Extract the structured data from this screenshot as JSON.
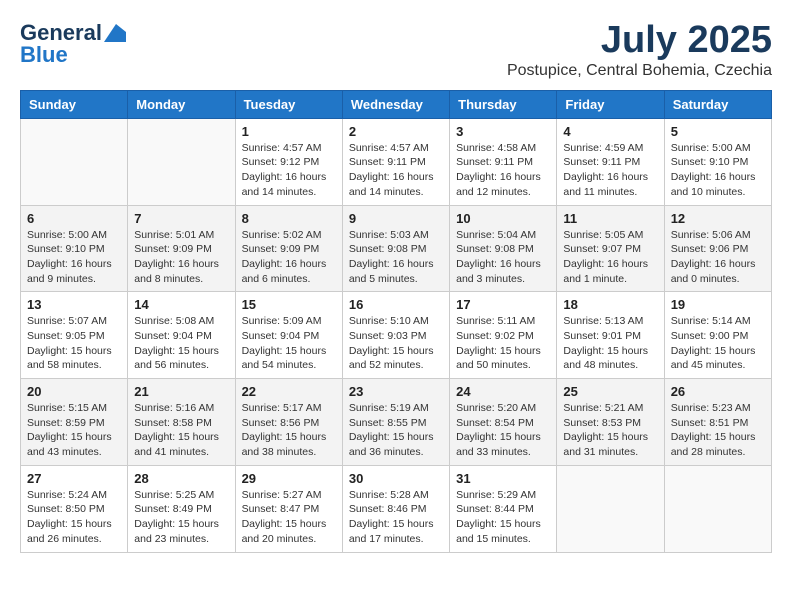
{
  "header": {
    "logo_line1": "General",
    "logo_line2": "Blue",
    "month": "July 2025",
    "location": "Postupice, Central Bohemia, Czechia"
  },
  "columns": [
    "Sunday",
    "Monday",
    "Tuesday",
    "Wednesday",
    "Thursday",
    "Friday",
    "Saturday"
  ],
  "weeks": [
    [
      {
        "day": "",
        "text": ""
      },
      {
        "day": "",
        "text": ""
      },
      {
        "day": "1",
        "text": "Sunrise: 4:57 AM\nSunset: 9:12 PM\nDaylight: 16 hours and 14 minutes."
      },
      {
        "day": "2",
        "text": "Sunrise: 4:57 AM\nSunset: 9:11 PM\nDaylight: 16 hours and 14 minutes."
      },
      {
        "day": "3",
        "text": "Sunrise: 4:58 AM\nSunset: 9:11 PM\nDaylight: 16 hours and 12 minutes."
      },
      {
        "day": "4",
        "text": "Sunrise: 4:59 AM\nSunset: 9:11 PM\nDaylight: 16 hours and 11 minutes."
      },
      {
        "day": "5",
        "text": "Sunrise: 5:00 AM\nSunset: 9:10 PM\nDaylight: 16 hours and 10 minutes."
      }
    ],
    [
      {
        "day": "6",
        "text": "Sunrise: 5:00 AM\nSunset: 9:10 PM\nDaylight: 16 hours and 9 minutes."
      },
      {
        "day": "7",
        "text": "Sunrise: 5:01 AM\nSunset: 9:09 PM\nDaylight: 16 hours and 8 minutes."
      },
      {
        "day": "8",
        "text": "Sunrise: 5:02 AM\nSunset: 9:09 PM\nDaylight: 16 hours and 6 minutes."
      },
      {
        "day": "9",
        "text": "Sunrise: 5:03 AM\nSunset: 9:08 PM\nDaylight: 16 hours and 5 minutes."
      },
      {
        "day": "10",
        "text": "Sunrise: 5:04 AM\nSunset: 9:08 PM\nDaylight: 16 hours and 3 minutes."
      },
      {
        "day": "11",
        "text": "Sunrise: 5:05 AM\nSunset: 9:07 PM\nDaylight: 16 hours and 1 minute."
      },
      {
        "day": "12",
        "text": "Sunrise: 5:06 AM\nSunset: 9:06 PM\nDaylight: 16 hours and 0 minutes."
      }
    ],
    [
      {
        "day": "13",
        "text": "Sunrise: 5:07 AM\nSunset: 9:05 PM\nDaylight: 15 hours and 58 minutes."
      },
      {
        "day": "14",
        "text": "Sunrise: 5:08 AM\nSunset: 9:04 PM\nDaylight: 15 hours and 56 minutes."
      },
      {
        "day": "15",
        "text": "Sunrise: 5:09 AM\nSunset: 9:04 PM\nDaylight: 15 hours and 54 minutes."
      },
      {
        "day": "16",
        "text": "Sunrise: 5:10 AM\nSunset: 9:03 PM\nDaylight: 15 hours and 52 minutes."
      },
      {
        "day": "17",
        "text": "Sunrise: 5:11 AM\nSunset: 9:02 PM\nDaylight: 15 hours and 50 minutes."
      },
      {
        "day": "18",
        "text": "Sunrise: 5:13 AM\nSunset: 9:01 PM\nDaylight: 15 hours and 48 minutes."
      },
      {
        "day": "19",
        "text": "Sunrise: 5:14 AM\nSunset: 9:00 PM\nDaylight: 15 hours and 45 minutes."
      }
    ],
    [
      {
        "day": "20",
        "text": "Sunrise: 5:15 AM\nSunset: 8:59 PM\nDaylight: 15 hours and 43 minutes."
      },
      {
        "day": "21",
        "text": "Sunrise: 5:16 AM\nSunset: 8:58 PM\nDaylight: 15 hours and 41 minutes."
      },
      {
        "day": "22",
        "text": "Sunrise: 5:17 AM\nSunset: 8:56 PM\nDaylight: 15 hours and 38 minutes."
      },
      {
        "day": "23",
        "text": "Sunrise: 5:19 AM\nSunset: 8:55 PM\nDaylight: 15 hours and 36 minutes."
      },
      {
        "day": "24",
        "text": "Sunrise: 5:20 AM\nSunset: 8:54 PM\nDaylight: 15 hours and 33 minutes."
      },
      {
        "day": "25",
        "text": "Sunrise: 5:21 AM\nSunset: 8:53 PM\nDaylight: 15 hours and 31 minutes."
      },
      {
        "day": "26",
        "text": "Sunrise: 5:23 AM\nSunset: 8:51 PM\nDaylight: 15 hours and 28 minutes."
      }
    ],
    [
      {
        "day": "27",
        "text": "Sunrise: 5:24 AM\nSunset: 8:50 PM\nDaylight: 15 hours and 26 minutes."
      },
      {
        "day": "28",
        "text": "Sunrise: 5:25 AM\nSunset: 8:49 PM\nDaylight: 15 hours and 23 minutes."
      },
      {
        "day": "29",
        "text": "Sunrise: 5:27 AM\nSunset: 8:47 PM\nDaylight: 15 hours and 20 minutes."
      },
      {
        "day": "30",
        "text": "Sunrise: 5:28 AM\nSunset: 8:46 PM\nDaylight: 15 hours and 17 minutes."
      },
      {
        "day": "31",
        "text": "Sunrise: 5:29 AM\nSunset: 8:44 PM\nDaylight: 15 hours and 15 minutes."
      },
      {
        "day": "",
        "text": ""
      },
      {
        "day": "",
        "text": ""
      }
    ]
  ]
}
